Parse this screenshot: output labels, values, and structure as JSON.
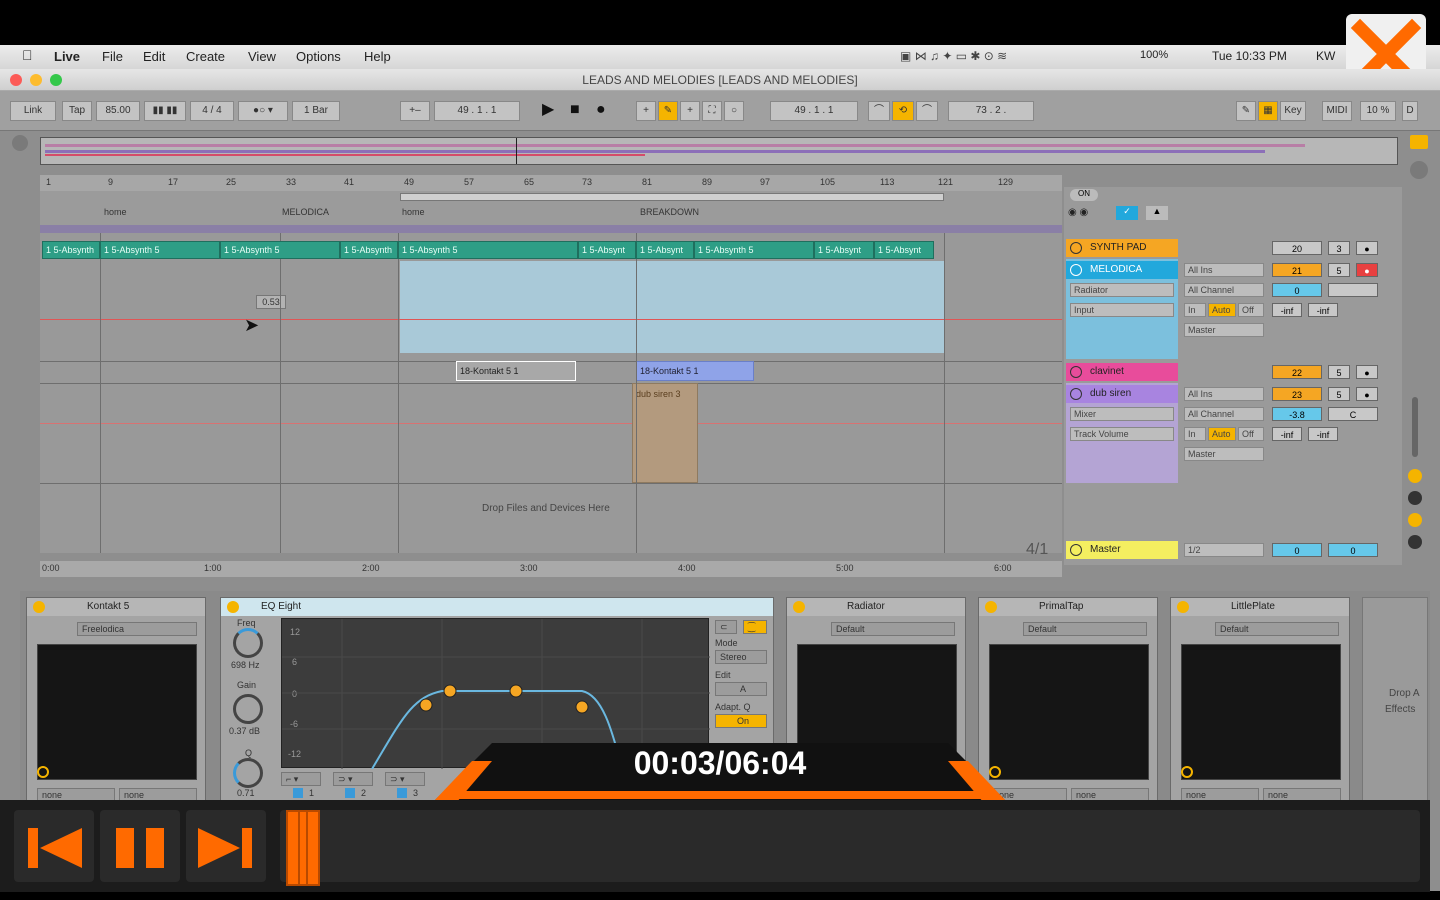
{
  "mac_menubar": {
    "apple": "",
    "items": [
      "Live",
      "File",
      "Edit",
      "Create",
      "View",
      "Options",
      "Help"
    ],
    "status": [
      "100%",
      "Tue 10:33 PM",
      "KW"
    ]
  },
  "window_title": "LEADS AND MELODIES  [LEADS AND MELODIES]",
  "transport": {
    "link": "Link",
    "tap": "Tap",
    "tempo": "85.00",
    "signature": "4 / 4",
    "quantize": "1 Bar",
    "position": "49 .  1 .  1",
    "loop_start": "49 .  1 .  1",
    "loop_length": "73 .  2 .",
    "key": "Key",
    "midi": "MIDI",
    "cpu": "10 %"
  },
  "ruler_marks": [
    "1",
    "9",
    "17",
    "25",
    "33",
    "41",
    "49",
    "57",
    "65",
    "73",
    "81",
    "89",
    "97",
    "105",
    "113",
    "121",
    "129"
  ],
  "locators": [
    "home",
    "MELODICA",
    "home",
    "BREAKDOWN"
  ],
  "clips": [
    {
      "label": "1 5-Absynth"
    },
    {
      "label": "1 5-Absynth 5"
    },
    {
      "label": "1 5-Absynth 5"
    },
    {
      "label": "1 5-Absynth"
    },
    {
      "label": "1 5-Absynth 5"
    },
    {
      "label": "1 5-Absynt"
    },
    {
      "label": "1 5-Absynt"
    },
    {
      "label": "1 5-Absynth 5"
    },
    {
      "label": "1 5-Absynt"
    },
    {
      "label": "1 5-Absynt"
    }
  ],
  "kontakt_clips": [
    "18-Kontakt 5 1",
    "18-Kontakt 5 1"
  ],
  "dub_clip": "dub siren 3",
  "tooltip_value": "0.53",
  "drop_text": "Drop Files and Devices Here",
  "timeline_marks": [
    "0:00",
    "1:00",
    "2:00",
    "3:00",
    "4:00",
    "5:00",
    "6:00"
  ],
  "tracks": [
    {
      "name": "SYNTH PAD",
      "color": "#f5a623",
      "vol": "20",
      "num": "3"
    },
    {
      "name": "MELODICA",
      "color": "#22a8dc",
      "vol": "21",
      "num": "5"
    },
    {
      "name": "clavinet",
      "color": "#e84c9b",
      "vol": "22",
      "num": "5"
    },
    {
      "name": "dub siren",
      "color": "#a884e0",
      "vol": "23",
      "num": "5"
    },
    {
      "name": "Master",
      "color": "#f4ee60",
      "vol": "0",
      "num": "0"
    }
  ],
  "melodica_io": {
    "device": "Radiator",
    "input": "Input",
    "in": "All Ins",
    "channel": "All Channel",
    "monitor": [
      "In",
      "Auto",
      "Off"
    ],
    "out": "Master",
    "vol": "0",
    "send1": "-inf",
    "send2": "-inf"
  },
  "dub_io": {
    "device": "Mixer",
    "input": "Track Volume",
    "in": "All Ins",
    "channel": "All Channel",
    "monitor": [
      "In",
      "Auto",
      "Off"
    ],
    "out": "Master",
    "vol": "-3.8",
    "pan": "C",
    "send1": "-inf",
    "send2": "-inf"
  },
  "signature_display": "4/1",
  "master_io": "1/2",
  "devices": [
    {
      "name": "Kontakt 5",
      "preset": "Freelodica",
      "x1": "none",
      "x2": "none"
    },
    {
      "name": "EQ Eight",
      "freq": "698 Hz",
      "gain": "0.37 dB",
      "q": "0.71",
      "mode": "Stereo",
      "adapt": "On",
      "labels": [
        "Freq",
        "Gain",
        "Q",
        "Mode",
        "Edit",
        "Adapt. Q"
      ],
      "scale": [
        "12",
        "6",
        "0",
        "-6",
        "-12"
      ],
      "bands": [
        "1",
        "2",
        "3"
      ]
    },
    {
      "name": "Radiator",
      "preset": "Default"
    },
    {
      "name": "PrimalTap",
      "preset": "Default",
      "x1": "none",
      "x2": "none"
    },
    {
      "name": "LittlePlate",
      "preset": "Default",
      "x1": "none",
      "x2": "none"
    }
  ],
  "drop_effects": [
    "Drop A",
    "Effects"
  ],
  "player": {
    "time": "00:03/06:04",
    "accent": "#ff6a00"
  }
}
